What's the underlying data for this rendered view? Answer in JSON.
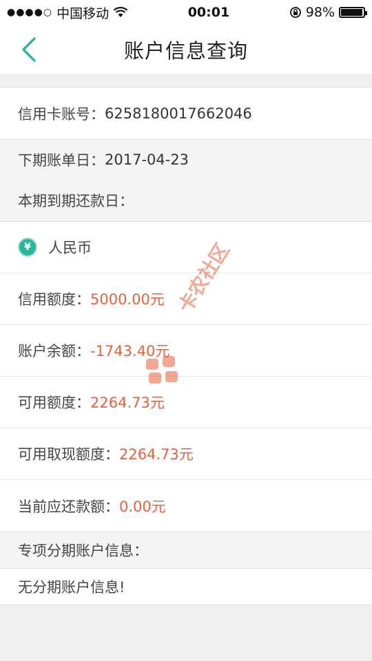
{
  "status_bar": {
    "signal": "●●●●○",
    "carrier": "中国移动",
    "time": "00:01",
    "battery": "98%",
    "battery_level": 0.98
  },
  "nav": {
    "title": "账户信息查询"
  },
  "account": {
    "card_label": "信用卡账号：",
    "card_number": "6258180017662046",
    "statement_label": "下期账单日：",
    "statement_date": "2017-04-23",
    "due_label": "本期到期还款日：",
    "due_date": ""
  },
  "rmb": {
    "currency_label": "人民币",
    "items": [
      {
        "label": "信用额度：",
        "value": "5000.00元"
      },
      {
        "label": "账户余额：",
        "value": "-1743.40元"
      },
      {
        "label": "可用额度：",
        "value": "2264.73元"
      },
      {
        "label": "可用取现额度：",
        "value": "2264.73元"
      },
      {
        "label": "当前应还款额：",
        "value": "0.00元"
      }
    ]
  },
  "installment": {
    "header": "专项分期账户信息：",
    "message": "无分期账户信息!"
  },
  "watermark": {
    "text": "卡农社区"
  },
  "colors": {
    "accent": "#2cb49c",
    "value_red": "#e8603c"
  }
}
